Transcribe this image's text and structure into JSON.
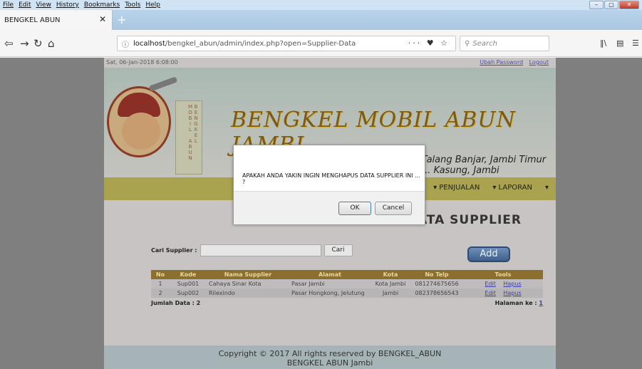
{
  "browser": {
    "menu": [
      "File",
      "Edit",
      "View",
      "History",
      "Bookmarks",
      "Tools",
      "Help"
    ],
    "tab_title": "BENGKEL ABUN",
    "url_host": "localhost",
    "url_path": "/bengkel_abun/admin/index.php?open=Supplier-Data",
    "search_placeholder": "Search"
  },
  "page": {
    "datetime": "Sat, 06-Jan-2018 6:08:00",
    "link_change_password": "Ubah Password",
    "link_logout": "Logout",
    "site_title": "BENGKEL MOBIL ABUN JAMBI",
    "site_subtitle": "Talang Banjar, Jambi Timur ... Kasung, Jambi",
    "ribbon_text": "BENGKEL MOBIL ABUN",
    "nav": [
      "PENJUALAN",
      "LAPORAN"
    ],
    "section_title": "DATA SUPPLIER",
    "search_label": "Cari Supplier :",
    "search_button": "Cari",
    "add_button": "Add",
    "table_headers": [
      "No",
      "Kode",
      "Nama Supplier",
      "Alamat",
      "Kota",
      "No Telp",
      "Tools"
    ],
    "rows": [
      [
        "1",
        "Sup001",
        "Cahaya Sinar Kota",
        "Pasar Jambi",
        "Kota Jambi",
        "081274675656"
      ],
      [
        "2",
        "Sup002",
        "Rilexindo",
        "Pasar Hongkong, Jelutung",
        "Jambi",
        "082378656543"
      ]
    ],
    "tool_edit": "Edit",
    "tool_delete": "Hapus",
    "total_label": "Jumlah Data : 2",
    "page_label": "Halaman ke :",
    "page_number": "1",
    "footer_line1": "Copyright © 2017 All rights reserved by BENGKEL_ABUN",
    "footer_line2": "BENGKEL ABUN Jambi"
  },
  "dialog": {
    "message": "APAKAH ANDA YAKIN INGIN MENGHAPUS DATA SUPPLIER INI ... ?",
    "ok": "OK",
    "cancel": "Cancel"
  }
}
